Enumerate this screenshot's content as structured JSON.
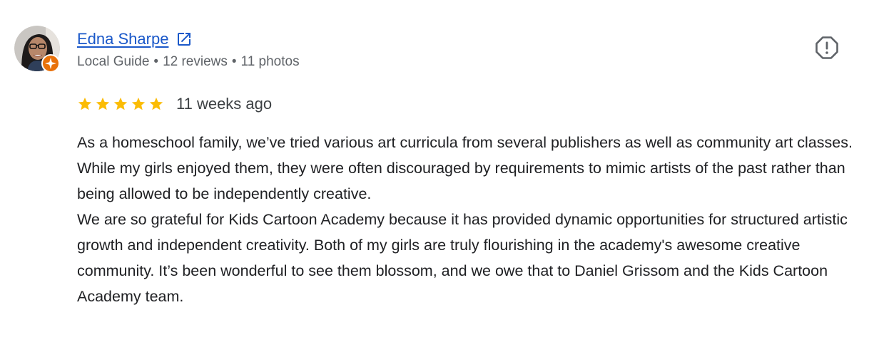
{
  "reviewer": {
    "name": "Edna Sharpe",
    "badge": "Local Guide",
    "reviews": "12 reviews",
    "photos": "11 photos",
    "separator": "•"
  },
  "review": {
    "rating": 5,
    "max_rating": 5,
    "time_ago": "11 weeks ago",
    "paragraphs": [
      "As a homeschool family, we’ve tried various art curricula from several publishers as well as community art classes. While my girls enjoyed them, they were often discouraged by requirements to mimic artists of the past rather than being allowed to be independently creative.",
      "We are so grateful for Kids Cartoon Academy because it has provided dynamic opportunities for structured artistic growth and independent creativity. Both of my girls are truly flourishing in the academy's awesome creative community. It’s been wonderful to see them blossom, and we owe that to Daniel Grissom and the Kids Cartoon Academy team."
    ]
  },
  "icons": {
    "external_link": "external-link-icon",
    "report": "report-icon",
    "star": "star-icon",
    "local_guide": "local-guide-badge-icon"
  },
  "colors": {
    "link": "#1a58c9",
    "star": "#fbbc04",
    "meta_text": "#5f6368",
    "body_text": "#202124",
    "badge": "#e8710a"
  }
}
